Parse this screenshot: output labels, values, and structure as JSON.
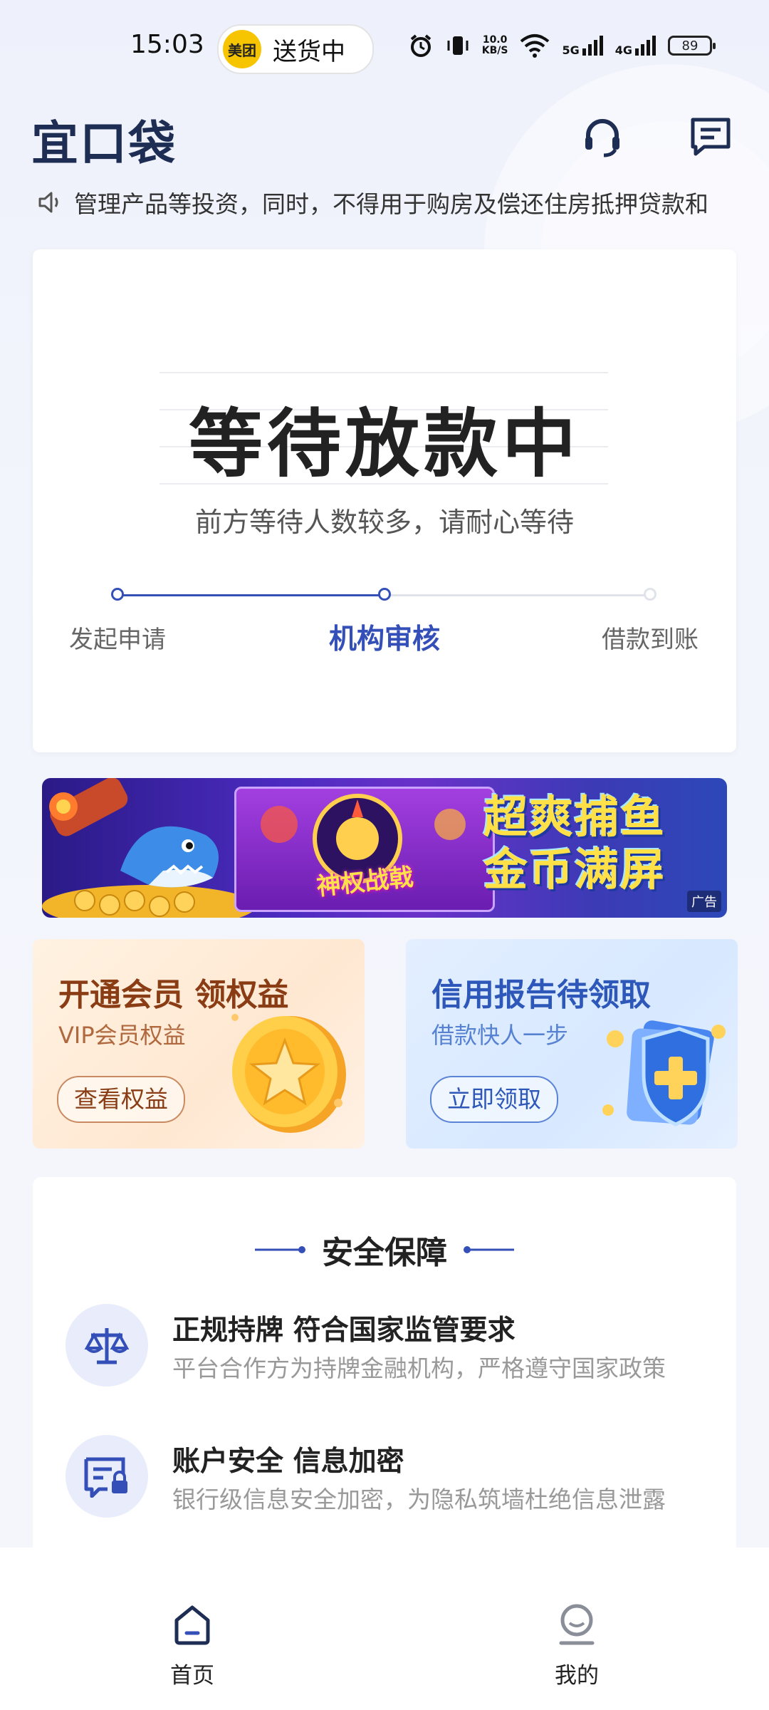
{
  "status_bar": {
    "time": "15:03",
    "pill_logo": "美团",
    "pill_text": "送货中",
    "speed_value": "10.0",
    "speed_unit": "KB/S",
    "network1": "5G",
    "network2": "4G",
    "battery": "89"
  },
  "header": {
    "logo": "宜口袋",
    "icons": [
      "headset-icon",
      "message-icon"
    ]
  },
  "notice": {
    "icon": "speaker-icon",
    "text": "管理产品等投资，同时，不得用于购房及偿还住房抵押贷款和"
  },
  "loan_status": {
    "title": "等待放款中",
    "subtitle": "前方等待人数较多，请耐心等待",
    "steps": [
      {
        "label": "发起申请"
      },
      {
        "label": "机构审核"
      },
      {
        "label": "借款到账"
      }
    ],
    "current_step": 1,
    "colors": {
      "active": "#3450b8",
      "inactive": "#e1e3ea"
    }
  },
  "ad": {
    "left_text": "神权战戟",
    "title_line1": "超爽捕鱼",
    "title_line2": "金币满屏",
    "tag": "广告"
  },
  "promos": {
    "vip": {
      "title": "开通会员 领权益",
      "subtitle": "VIP会员权益",
      "button": "查看权益"
    },
    "credit": {
      "title": "信用报告待领取",
      "subtitle": "借款快人一步",
      "button": "立即领取"
    }
  },
  "security": {
    "title": "安全保障",
    "items": [
      {
        "icon": "scale-icon",
        "title": "正规持牌 符合国家监管要求",
        "desc": "平台合作方为持牌金融机构，严格遵守国家政策"
      },
      {
        "icon": "secure-id-icon",
        "title": "账户安全 信息加密",
        "desc": "银行级信息安全加密，为隐私筑墙杜绝信息泄露"
      }
    ]
  },
  "bottom_nav": {
    "items": [
      {
        "label": "首页",
        "icon": "home-icon"
      },
      {
        "label": "我的",
        "icon": "profile-icon"
      }
    ]
  }
}
